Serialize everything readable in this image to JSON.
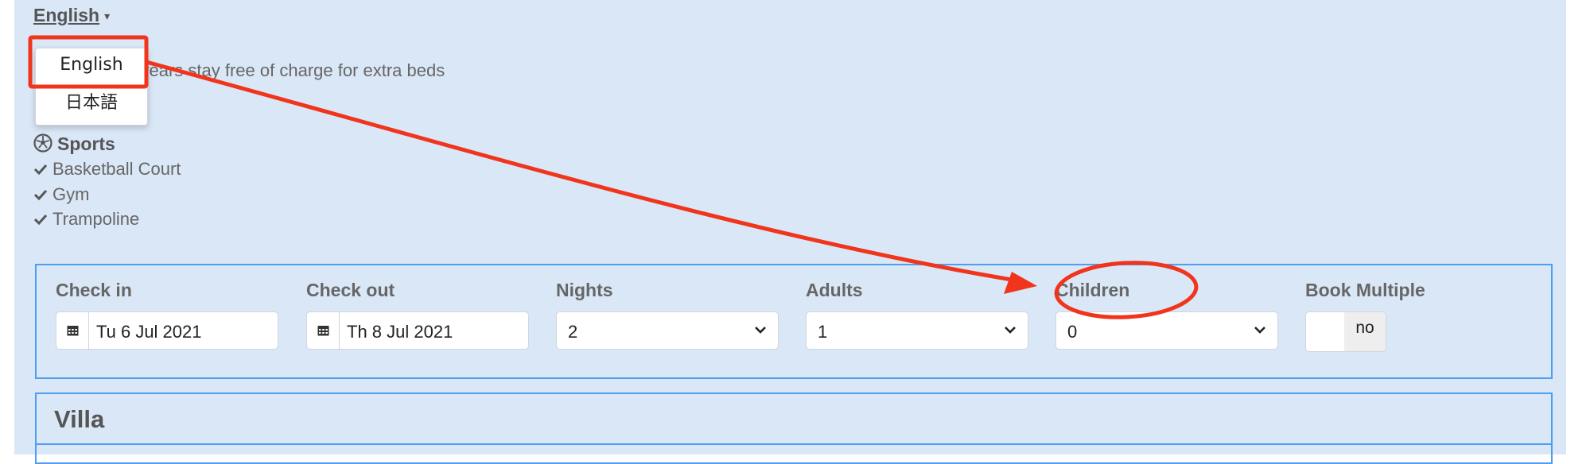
{
  "language": {
    "current": "English",
    "options": [
      "English",
      "日本語"
    ]
  },
  "note": "der 12 years stay free of charge for extra beds",
  "sports": {
    "title": "Sports",
    "items": [
      "Basketball Court",
      "Gym",
      "Trampoline"
    ]
  },
  "booking": {
    "check_in": {
      "label": "Check in",
      "value": "Tu 6 Jul 2021"
    },
    "check_out": {
      "label": "Check out",
      "value": "Th 8 Jul 2021"
    },
    "nights": {
      "label": "Nights",
      "value": "2"
    },
    "adults": {
      "label": "Adults",
      "value": "1"
    },
    "children": {
      "label": "Children",
      "value": "0"
    },
    "book_multiple": {
      "label": "Book Multiple",
      "value": "no"
    }
  },
  "villa": {
    "title": "Villa"
  },
  "annotation_color": "#f0351c"
}
